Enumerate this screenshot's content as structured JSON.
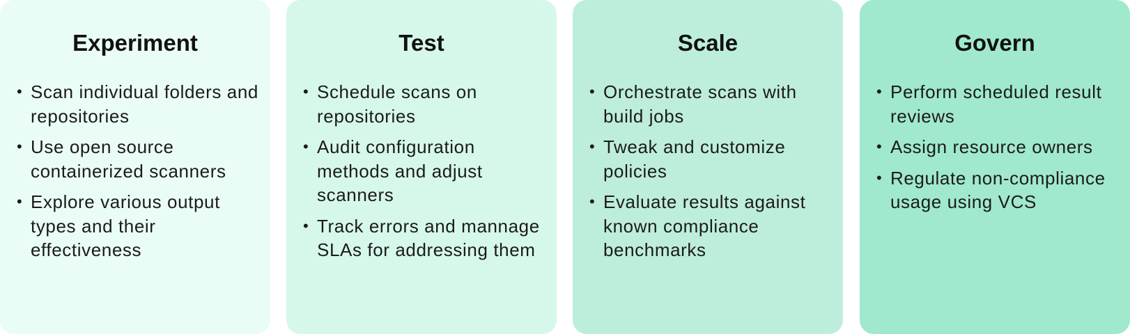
{
  "stages": [
    {
      "title": "Experiment",
      "color": "#eafcf6",
      "items": [
        "Scan individual folders and repositories",
        "Use open source containerized scanners",
        "Explore various output types and their effectiveness"
      ]
    },
    {
      "title": "Test",
      "color": "#d6f8ea",
      "items": [
        "Schedule scans on repositories",
        "Audit configuration methods and adjust scanners",
        "Track errors and mannage SLAs for addressing them"
      ]
    },
    {
      "title": "Scale",
      "color": "#bdeedb",
      "items": [
        "Orchestrate scans with build jobs",
        "Tweak and customize policies",
        "Evaluate results against known compliance benchmarks"
      ]
    },
    {
      "title": "Govern",
      "color": "#a0e9cc",
      "items": [
        "Perform scheduled result reviews",
        "Assign resource owners",
        "Regulate non-compliance usage using VCS"
      ]
    }
  ],
  "bullet_glyph": "•"
}
